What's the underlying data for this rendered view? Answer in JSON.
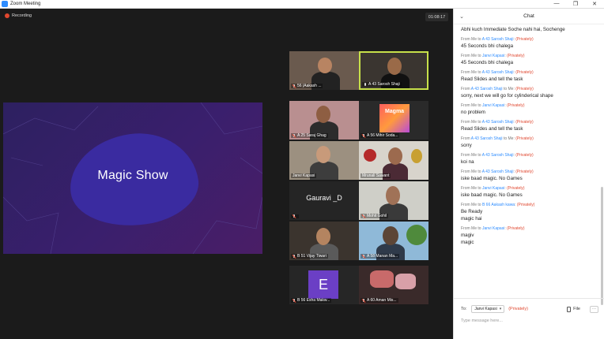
{
  "window": {
    "title": "Zoom Meeting",
    "controls": [
      "—",
      "❐",
      "✕"
    ]
  },
  "meeting": {
    "recording_label": "Recording",
    "timer": "01:08:17",
    "share_title": "Magic Show",
    "participants": [
      {
        "label": "56 |Aakash ...",
        "mic": "off",
        "pin": true
      },
      {
        "label": "A 43 Sarosh Shaji",
        "mic": "on",
        "active": true,
        "pin": true
      },
      {
        "label": "A 25 Saraj Ghag",
        "mic": "off"
      },
      {
        "label": "A 56 Mihir Soda...",
        "mic": "off"
      },
      {
        "label": "Janvi Kapasi",
        "mic": "none"
      },
      {
        "label": "Mrunali Sawant",
        "mic": "none"
      },
      {
        "label": "Gauravi _D",
        "mic": "off",
        "name_only": true
      },
      {
        "label": "Mohit Gohil",
        "mic": "off"
      },
      {
        "label": "B 51 Vijay Tiwari",
        "mic": "off"
      },
      {
        "label": "A 58 Manan Ma...",
        "mic": "off"
      },
      {
        "label": "B 56 Esha Makw...",
        "mic": "off",
        "avatar_letter": "E"
      },
      {
        "label": "A 60 Aman Mis...",
        "mic": "off"
      }
    ],
    "magma_text": "Magma",
    "big_name": "Gauravi _D"
  },
  "chat": {
    "title": "Chat",
    "messages": [
      {
        "meta": null,
        "text": [
          "Abhi kuch Immediate Soche nahi hai, Sochenge"
        ]
      },
      {
        "from": "From Me to",
        "to": "A 43 Sarosh Shaji",
        "priv": "(Privately)",
        "text": [
          "45 Seconds bhi chalega"
        ]
      },
      {
        "from": "From Me to",
        "to": "Janvi Kapasi",
        "priv": "(Privately)",
        "text": [
          "45 Seconds bhi chalega"
        ]
      },
      {
        "from": "From Me to",
        "to": "A 43 Sarosh Shaji",
        "priv": "(Privately)",
        "text": [
          "Read Slides and tell the task"
        ]
      },
      {
        "from": "From",
        "fromname": "A 43 Sarosh Shaji",
        "tome": "to Me:",
        "priv": "(Privately)",
        "text": [
          "sorry, next we will go for cylinderical shape"
        ]
      },
      {
        "from": "From Me to",
        "to": "Janvi Kapasi",
        "priv": "(Privately)",
        "text": [
          "no problem"
        ]
      },
      {
        "from": "From Me to",
        "to": "A 43 Sarosh Shaji",
        "priv": "(Privately)",
        "text": [
          "Read Slides and tell the task"
        ]
      },
      {
        "from": "From",
        "fromname": "A 43 Sarosh Shaji",
        "tome": "to Me:",
        "priv": "(Privately)",
        "text": [
          "sorry"
        ]
      },
      {
        "from": "From Me to",
        "to": "A 43 Sarosh Shaji",
        "priv": "(Privately)",
        "text": [
          "koi na"
        ]
      },
      {
        "from": "From Me to",
        "to": "A 43 Sarosh Shaji",
        "priv": "(Privately)",
        "text": [
          "iske baad magic. No Games"
        ]
      },
      {
        "from": "From Me to",
        "to": "Janvi Kapasi",
        "priv": "(Privately)",
        "text": [
          "iske baad magic. No Games"
        ]
      },
      {
        "from": "From Me to",
        "to": "B 66 Aakash kawa",
        "priv": "(Privately)",
        "text": [
          "Be Ready",
          "magic hai"
        ]
      },
      {
        "from": "From Me to",
        "to": "Janvi Kapasi",
        "priv": "(Privately)",
        "text": [
          "magiv",
          "magic"
        ]
      }
    ],
    "footer": {
      "to_label": "To:",
      "recipient": "Janvi Kapasi",
      "priv": "(Privately)",
      "file_label": "File",
      "more_label": "···",
      "input_placeholder": "Type message here..."
    }
  }
}
